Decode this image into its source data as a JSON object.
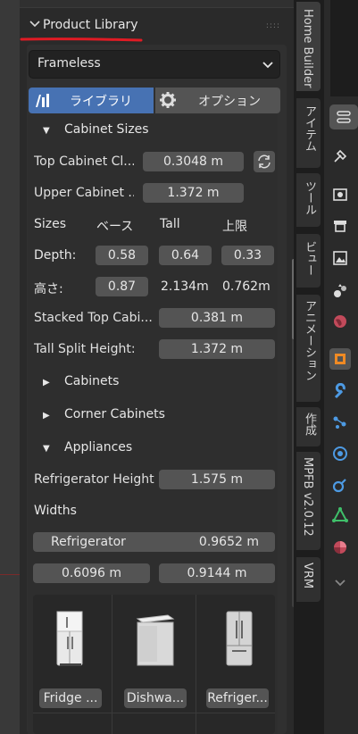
{
  "panel": {
    "section_title": "Product Library",
    "style_select": "Frameless",
    "tabs": [
      {
        "label": "ライブラリ",
        "active": true
      },
      {
        "label": "オプション",
        "active": false
      }
    ]
  },
  "cabinet_sizes": {
    "header": "Cabinet Sizes",
    "top_cabinet_label": "Top Cabinet Cl...",
    "top_cabinet_value": "0.3048 m",
    "upper_cabinet_label": "Upper Cabinet ...",
    "upper_cabinet_value": "1.372 m",
    "col_sizes": "Sizes",
    "col_base": "ベース",
    "col_tall": "Tall",
    "col_upper": "上限",
    "depth_label": "Depth:",
    "depth_base": "0.58",
    "depth_tall": "0.64",
    "depth_upper": "0.33",
    "height_label": "高さ:",
    "height_base": "0.87",
    "height_tall": "2.134m",
    "height_upper": "0.762m",
    "stacked_label": "Stacked Top Cabi...",
    "stacked_value": "0.381 m",
    "tall_split_label": "Tall Split Height:",
    "tall_split_value": "1.372 m"
  },
  "sections": {
    "cabinets": "Cabinets",
    "corner_cabinets": "Corner Cabinets",
    "appliances": "Appliances"
  },
  "appliances": {
    "fridge_height_label": "Refrigerator Height",
    "fridge_height_value": "1.575 m",
    "widths_label": "Widths",
    "refrigerator_label": "Refrigerator",
    "refrigerator_value": "0.9652 m",
    "width_a": "0.6096 m",
    "width_b": "0.9144 m",
    "thumbnails": [
      {
        "label": "Fridge ..."
      },
      {
        "label": "Dishwa..."
      },
      {
        "label": "Refriger..."
      }
    ]
  },
  "sidebar_tabs": [
    "Home Builder",
    "アイテム",
    "ツール",
    "ビュー",
    "アニメーション",
    "作成",
    "MPFB v2.0.12",
    "VRM"
  ],
  "colors": {
    "accent": "#4772b3",
    "annotation_red": "#e01b24",
    "panel_bg": "#303030",
    "field_bg": "#545454"
  }
}
